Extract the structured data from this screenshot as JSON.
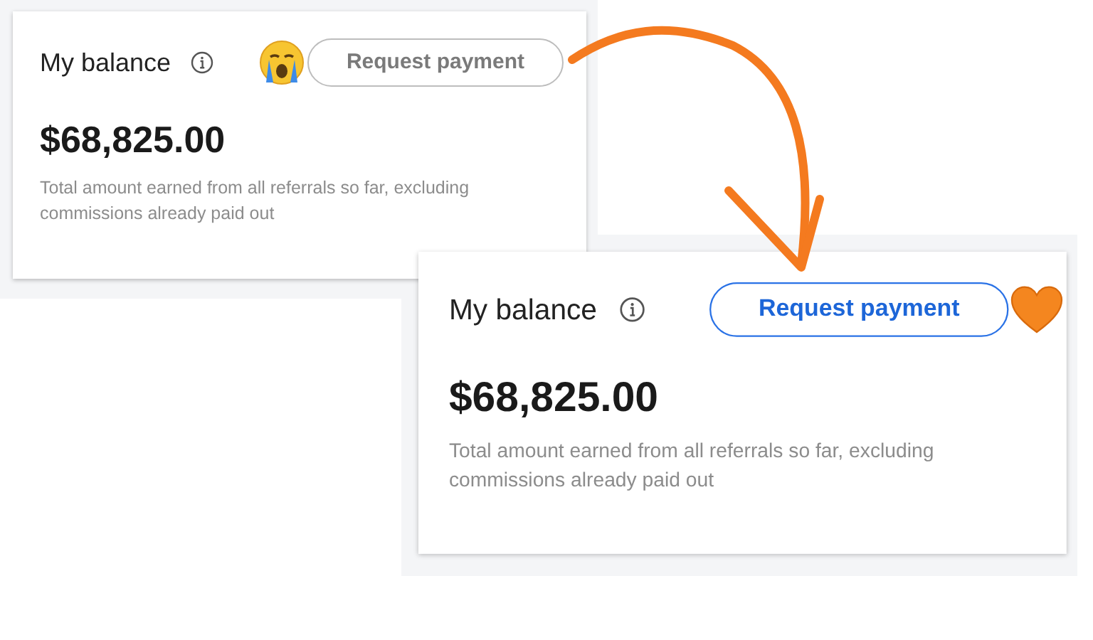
{
  "cards": [
    {
      "title": "My balance",
      "button": {
        "label": "Request payment",
        "emphasized": false
      },
      "emoji": {
        "kind": "crying"
      },
      "amount": "$68,825.00",
      "description": "Total amount earned from all referrals so far, excluding commissions already paid out"
    },
    {
      "title": "My balance",
      "button": {
        "label": "Request payment",
        "emphasized": true
      },
      "emoji": {
        "kind": "heart"
      },
      "amount": "$68,825.00",
      "description": "Total amount earned from all referrals so far, excluding commissions already paid out"
    }
  ]
}
